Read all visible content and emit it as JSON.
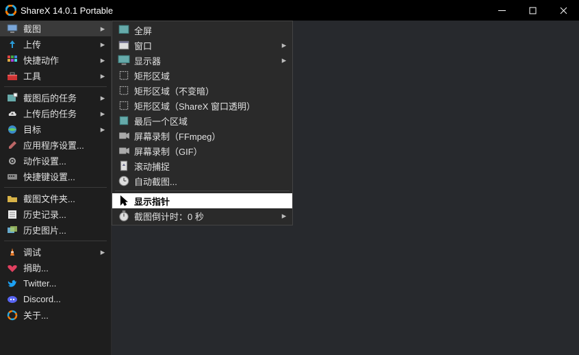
{
  "window": {
    "title": "ShareX 14.0.1 Portable"
  },
  "sidebar": {
    "items": [
      {
        "label": "截图",
        "chev": true
      },
      {
        "label": "上传",
        "chev": true
      },
      {
        "label": "快捷动作",
        "chev": true
      },
      {
        "label": "工具",
        "chev": true
      },
      "sep",
      {
        "label": "截图后的任务",
        "chev": true
      },
      {
        "label": "上传后的任务",
        "chev": true
      },
      {
        "label": "目标",
        "chev": true
      },
      {
        "label": "应用程序设置...",
        "chev": false
      },
      {
        "label": "动作设置...",
        "chev": false
      },
      {
        "label": "快捷键设置...",
        "chev": false
      },
      "sep",
      {
        "label": "截图文件夹...",
        "chev": false
      },
      {
        "label": "历史记录...",
        "chev": false
      },
      {
        "label": "历史图片...",
        "chev": false
      },
      "sep",
      {
        "label": "调试",
        "chev": true
      },
      {
        "label": "捐助...",
        "chev": false
      },
      {
        "label": "Twitter...",
        "chev": false
      },
      {
        "label": "Discord...",
        "chev": false
      },
      {
        "label": "关于...",
        "chev": false
      }
    ]
  },
  "submenu": {
    "items": [
      {
        "label": "全屏",
        "chev": false
      },
      {
        "label": "窗口",
        "chev": true
      },
      {
        "label": "显示器",
        "chev": true
      },
      {
        "label": "矩形区域",
        "chev": false
      },
      {
        "label": "矩形区域（不变暗）",
        "chev": false
      },
      {
        "label": "矩形区域（ShareX 窗口透明）",
        "chev": false
      },
      {
        "label": "最后一个区域",
        "chev": false
      },
      {
        "label": "屏幕录制（FFmpeg）",
        "chev": false
      },
      {
        "label": "屏幕录制（GIF）",
        "chev": false
      },
      {
        "label": "滚动捕捉",
        "chev": false
      },
      {
        "label": "自动截图...",
        "chev": false
      },
      "sep",
      {
        "label": "显示指针",
        "chev": false,
        "selected": true
      },
      {
        "label": "截图倒计时：0 秒",
        "chev": true
      }
    ]
  }
}
